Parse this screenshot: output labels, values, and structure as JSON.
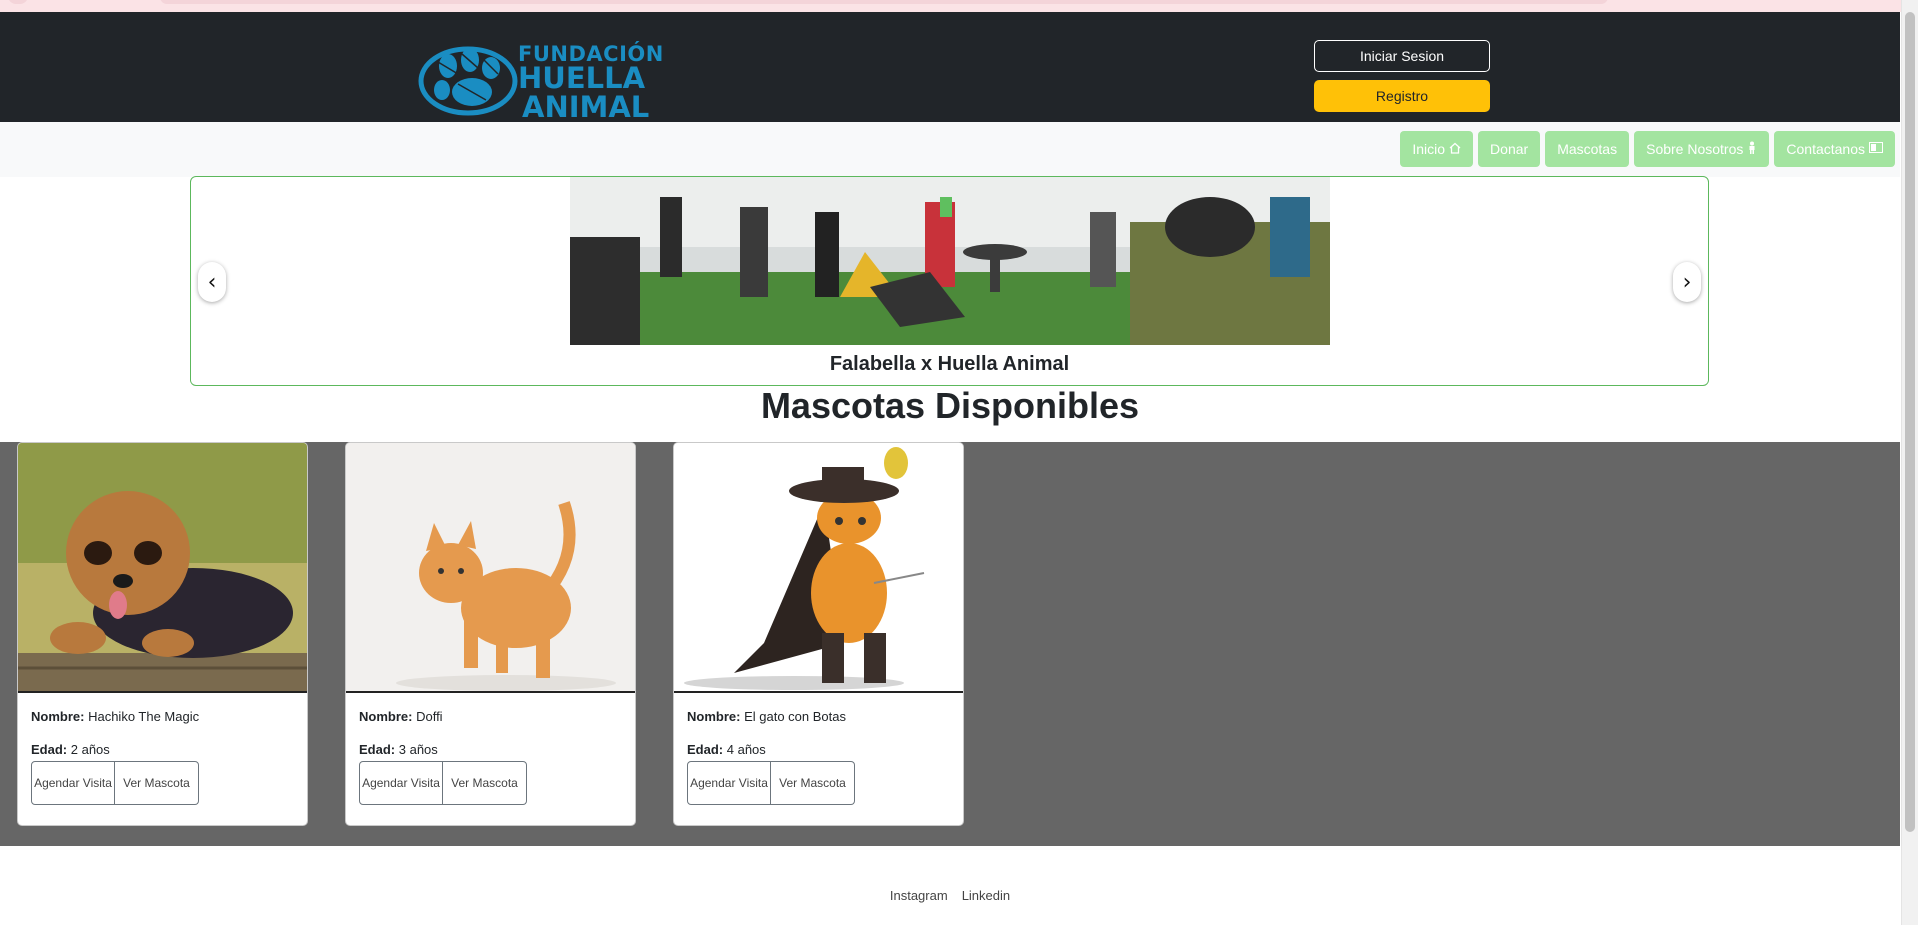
{
  "brand": {
    "logo_line1": "FUNDACIÓN",
    "logo_line2": "HUELLA",
    "logo_line3": "ANIMAL",
    "color": "#1a8dc2"
  },
  "header": {
    "login_label": "Iniciar Sesion",
    "register_label": "Registro",
    "register_color": "#ffc107"
  },
  "nav": {
    "items": [
      {
        "label": "Inicio",
        "icon": "house-icon"
      },
      {
        "label": "Donar",
        "icon": ""
      },
      {
        "label": "Mascotas",
        "icon": ""
      },
      {
        "label": "Sobre Nosotros",
        "icon": "person-icon"
      },
      {
        "label": "Contactanos",
        "icon": "card-icon"
      }
    ],
    "color": "#a3e4a0"
  },
  "carousel": {
    "caption": "Falabella x Huella Animal",
    "prev_label": "‹",
    "next_label": "›"
  },
  "section": {
    "title": "Mascotas Disponibles"
  },
  "pets": [
    {
      "name_label": "Nombre:",
      "name": "Hachiko The Magic",
      "age_label": "Edad:",
      "age": "2 años",
      "schedule_label": "Agendar Visita",
      "view_label": "Ver Mascota",
      "photo": "dog-photo"
    },
    {
      "name_label": "Nombre:",
      "name": "Doffi",
      "age_label": "Edad:",
      "age": "3 años",
      "schedule_label": "Agendar Visita",
      "view_label": "Ver Mascota",
      "photo": "cat-photo"
    },
    {
      "name_label": "Nombre:",
      "name": "El gato con Botas",
      "age_label": "Edad:",
      "age": "4 años",
      "schedule_label": "Agendar Visita",
      "view_label": "Ver Mascota",
      "photo": "puss-in-boots-photo"
    }
  ],
  "footer": {
    "links": [
      "Instagram",
      "Linkedin"
    ]
  }
}
